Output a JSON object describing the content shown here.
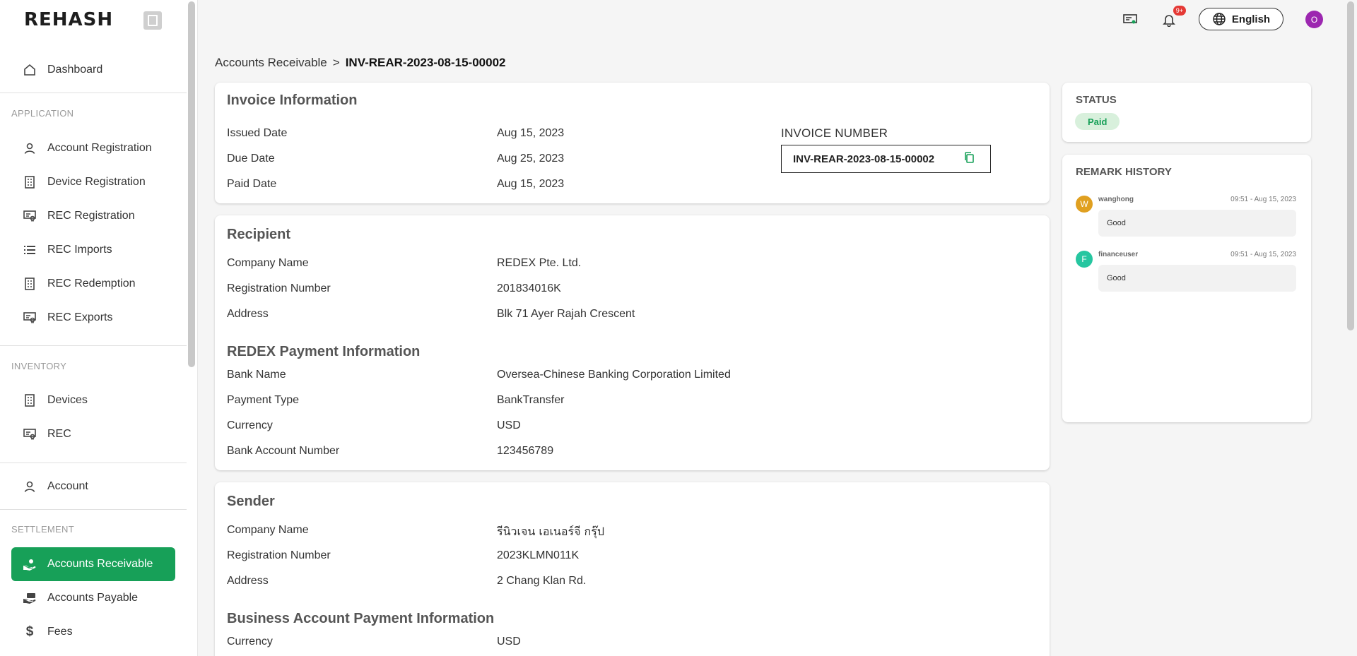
{
  "brand": {
    "logo": "REHASH"
  },
  "sidebar": {
    "dashboard": "Dashboard",
    "application_label": "APPLICATION",
    "application": [
      "Account Registration",
      "Device Registration",
      "REC Registration",
      "REC Imports",
      "REC Redemption",
      "REC Exports"
    ],
    "inventory_label": "INVENTORY",
    "inventory": [
      "Devices",
      "REC"
    ],
    "account": "Account",
    "settlement_label": "SETTLEMENT",
    "settlement": [
      "Accounts Receivable",
      "Accounts Payable",
      "Fees"
    ]
  },
  "header": {
    "notification_count": "9+",
    "language": "English",
    "avatar_initial": "O"
  },
  "breadcrumb": {
    "parent": "Accounts Receivable",
    "separator": ">",
    "current": "INV-REAR-2023-08-15-00002"
  },
  "invoice": {
    "title": "Invoice Information",
    "issued_label": "Issued Date",
    "issued_value": "Aug 15, 2023",
    "due_label": "Due Date",
    "due_value": "Aug 25, 2023",
    "paid_label": "Paid Date",
    "paid_value": "Aug 15, 2023",
    "number_label": "INVOICE NUMBER",
    "number_value": "INV-REAR-2023-08-15-00002"
  },
  "recipient": {
    "title": "Recipient",
    "company_label": "Company Name",
    "company_value": "REDEX Pte. Ltd.",
    "reg_label": "Registration Number",
    "reg_value": "201834016K",
    "address_label": "Address",
    "address_value": "Blk 71 Ayer Rajah Crescent",
    "payment_title": "REDEX Payment Information",
    "bank_label": "Bank Name",
    "bank_value": "Oversea-Chinese Banking Corporation Limited",
    "type_label": "Payment Type",
    "type_value": "BankTransfer",
    "currency_label": "Currency",
    "currency_value": "USD",
    "account_label": "Bank Account Number",
    "account_value": "123456789"
  },
  "sender": {
    "title": "Sender",
    "company_label": "Company Name",
    "company_value": "รีนิวเจน เอเนอร์จี กรุ๊ป",
    "reg_label": "Registration Number",
    "reg_value": "2023KLMN011K",
    "address_label": "Address",
    "address_value": "2 Chang Klan Rd.",
    "payment_title": "Business Account Payment Information",
    "currency_label": "Currency",
    "currency_value": "USD"
  },
  "status": {
    "title": "STATUS",
    "value": "Paid"
  },
  "remarks": {
    "title": "REMARK HISTORY",
    "items": [
      {
        "initial": "W",
        "user": "wanghong",
        "time": "09:51 - Aug 15, 2023",
        "text": "Good",
        "color": "#e0a020"
      },
      {
        "initial": "F",
        "user": "financeuser",
        "time": "09:51 - Aug 15, 2023",
        "text": "Good",
        "color": "#26c6a0"
      }
    ]
  },
  "colors": {
    "accent": "#17a058",
    "status_bg": "#d8f0dc",
    "avatar": "#9c27b0"
  }
}
